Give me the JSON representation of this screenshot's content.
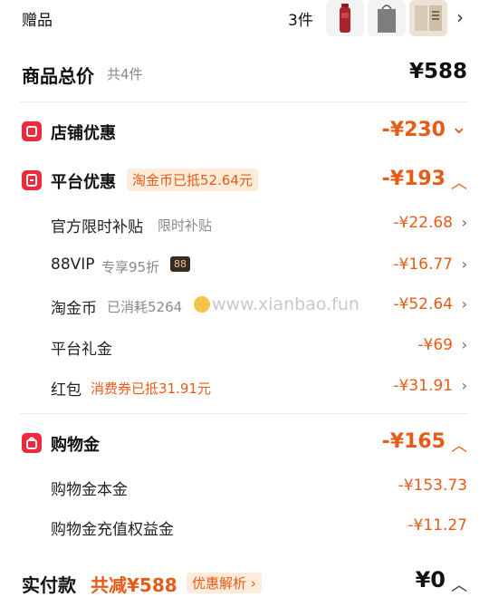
{
  "gifts": {
    "label": "赠品",
    "count": "3件"
  },
  "total": {
    "label": "商品总价",
    "count": "共4件",
    "price": "¥588"
  },
  "store_discount": {
    "title": "店铺优惠",
    "amount": "-¥230"
  },
  "platform_discount": {
    "title": "平台优惠",
    "badge": "淘金币已抵52.64元",
    "amount": "-¥193",
    "items": [
      {
        "label": "官方限时补贴",
        "note": "限时补贴",
        "amount": "-¥22.68"
      },
      {
        "label": "88VIP",
        "note": "专享95折",
        "tag": "88",
        "amount": "-¥16.77"
      },
      {
        "label": "淘金币",
        "note": "已消耗5264",
        "amount": "-¥52.64"
      },
      {
        "label": "平台礼金",
        "amount": "-¥69"
      },
      {
        "label": "红包",
        "note": "消费券已抵31.91元",
        "amount": "-¥31.91"
      }
    ]
  },
  "shopping_credit": {
    "title": "购物金",
    "amount": "-¥165",
    "items": [
      {
        "label": "购物金本金",
        "amount": "-¥153.73"
      },
      {
        "label": "购物金充值权益金",
        "amount": "-¥11.27"
      }
    ]
  },
  "paid": {
    "label": "实付款",
    "reduce": "共减¥588",
    "analysis": "优惠解析",
    "price": "¥0"
  },
  "watermark": "www.xianbao.fun",
  "colors": {
    "accent": "#e85a17",
    "icon_red": "#ee2a3b",
    "badge_bg": "#fdecd9"
  }
}
